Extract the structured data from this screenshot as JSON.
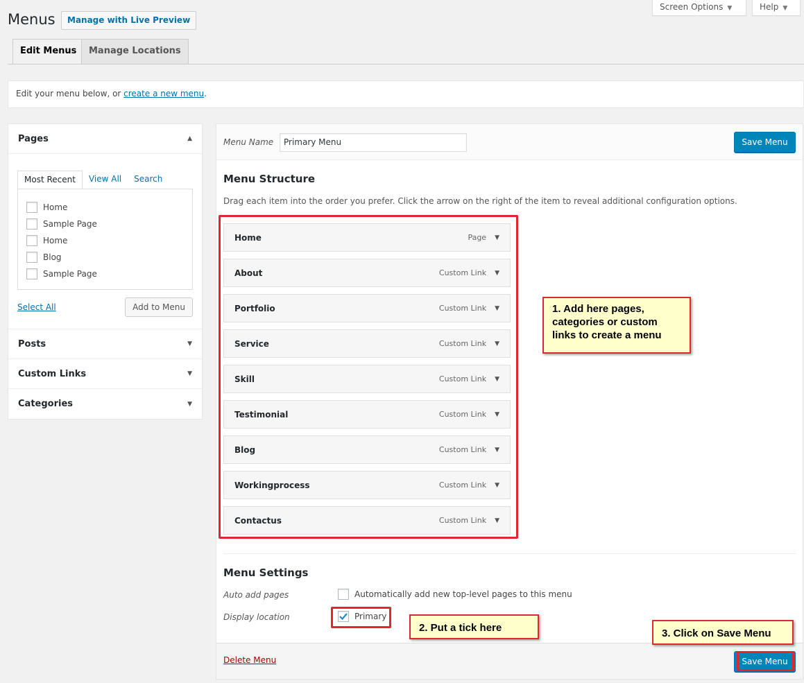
{
  "header": {
    "title": "Menus",
    "live_preview": "Manage with Live Preview",
    "screen_options": "Screen Options",
    "help": "Help"
  },
  "tabs": [
    {
      "label": "Edit Menus"
    },
    {
      "label": "Manage Locations"
    }
  ],
  "notice": {
    "prefix": "Edit your menu below, or ",
    "link": "create a new menu",
    "suffix": "."
  },
  "sidebar": {
    "pages_title": "Pages",
    "inner_tabs": [
      "Most Recent",
      "View All",
      "Search"
    ],
    "pages": [
      "Home",
      "Sample Page",
      "Home",
      "Blog",
      "Sample Page"
    ],
    "select_all": "Select All",
    "add_to_menu": "Add to Menu",
    "sections": [
      "Posts",
      "Custom Links",
      "Categories"
    ]
  },
  "main": {
    "menu_name_label": "Menu Name",
    "menu_name_value": "Primary Menu",
    "save_label": "Save Menu",
    "structure_title": "Menu Structure",
    "structure_desc": "Drag each item into the order you prefer. Click the arrow on the right of the item to reveal additional configuration options.",
    "items": [
      {
        "title": "Home",
        "type": "Page"
      },
      {
        "title": "About",
        "type": "Custom Link"
      },
      {
        "title": "Portfolio",
        "type": "Custom Link"
      },
      {
        "title": "Service",
        "type": "Custom Link"
      },
      {
        "title": "Skill",
        "type": "Custom Link"
      },
      {
        "title": "Testimonial",
        "type": "Custom Link"
      },
      {
        "title": "Blog",
        "type": "Custom Link"
      },
      {
        "title": "Workingprocess",
        "type": "Custom Link"
      },
      {
        "title": "Contactus",
        "type": "Custom Link"
      }
    ],
    "settings_title": "Menu Settings",
    "auto_add_label": "Auto add pages",
    "auto_add_option": "Automatically add new top-level pages to this menu",
    "display_location_label": "Display location",
    "primary_option": "Primary",
    "delete_menu": "Delete Menu"
  },
  "callouts": {
    "one": "1. Add here pages, categories or custom links to create a menu",
    "two": "2. Put a tick here",
    "three": "3. Click on Save Menu"
  },
  "colors": {
    "primary_button": "#0085ba",
    "link": "#0073aa",
    "annotation_red": "#e1262c",
    "callout_bg": "#ffffcc",
    "delete_link": "#aa0000"
  }
}
